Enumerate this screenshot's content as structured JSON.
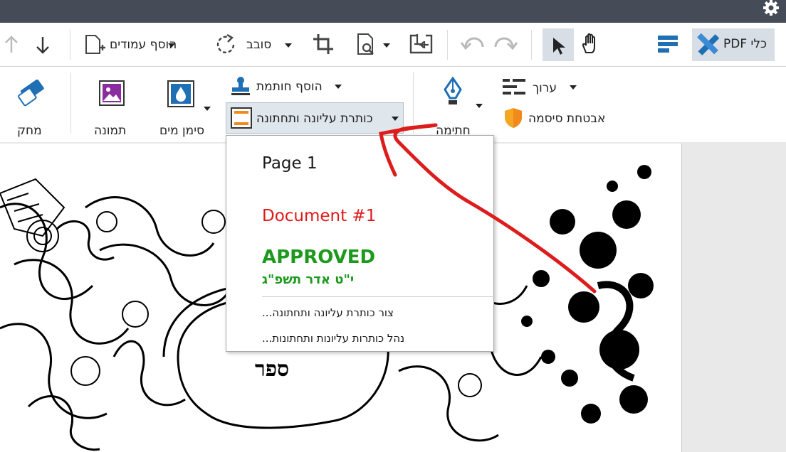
{
  "toolbar_top": {
    "add_pages_label": "הוסף עמודים",
    "rotate_label": "סובב",
    "pdf_tools_label": "כלי PDF"
  },
  "toolbar_main": {
    "add_stamp_label": "הוסף חותמת",
    "header_footer_label": "כותרת עליונה ותחתונה",
    "watermark_label": "סימן מים",
    "image_label": "תמונה",
    "eraser_label": "מחק",
    "edit_label": "ערוך",
    "signature_label": "חתימה",
    "password_security_label": "אבטחת סיסמה"
  },
  "header_footer_menu": {
    "items": [
      {
        "label": "Page 1",
        "color": "#1a1a1a"
      },
      {
        "label": "Document #1",
        "color": "#e01818"
      },
      {
        "label": "APPROVED",
        "sublabel": "י\"ט אדר תשפ\"ג",
        "color": "#1d9a1d"
      }
    ],
    "create_label": "צור כותרת עליונה ותחתונה...",
    "manage_label": "נהל כותרות עליונות ותחתונות..."
  },
  "document": {
    "visible_text": "ספר"
  },
  "colors": {
    "titlebar": "#464b58",
    "active_highlight": "#d7dee6",
    "accent_blue": "#1f6fb5",
    "annotation_red": "#dd1c1c"
  }
}
